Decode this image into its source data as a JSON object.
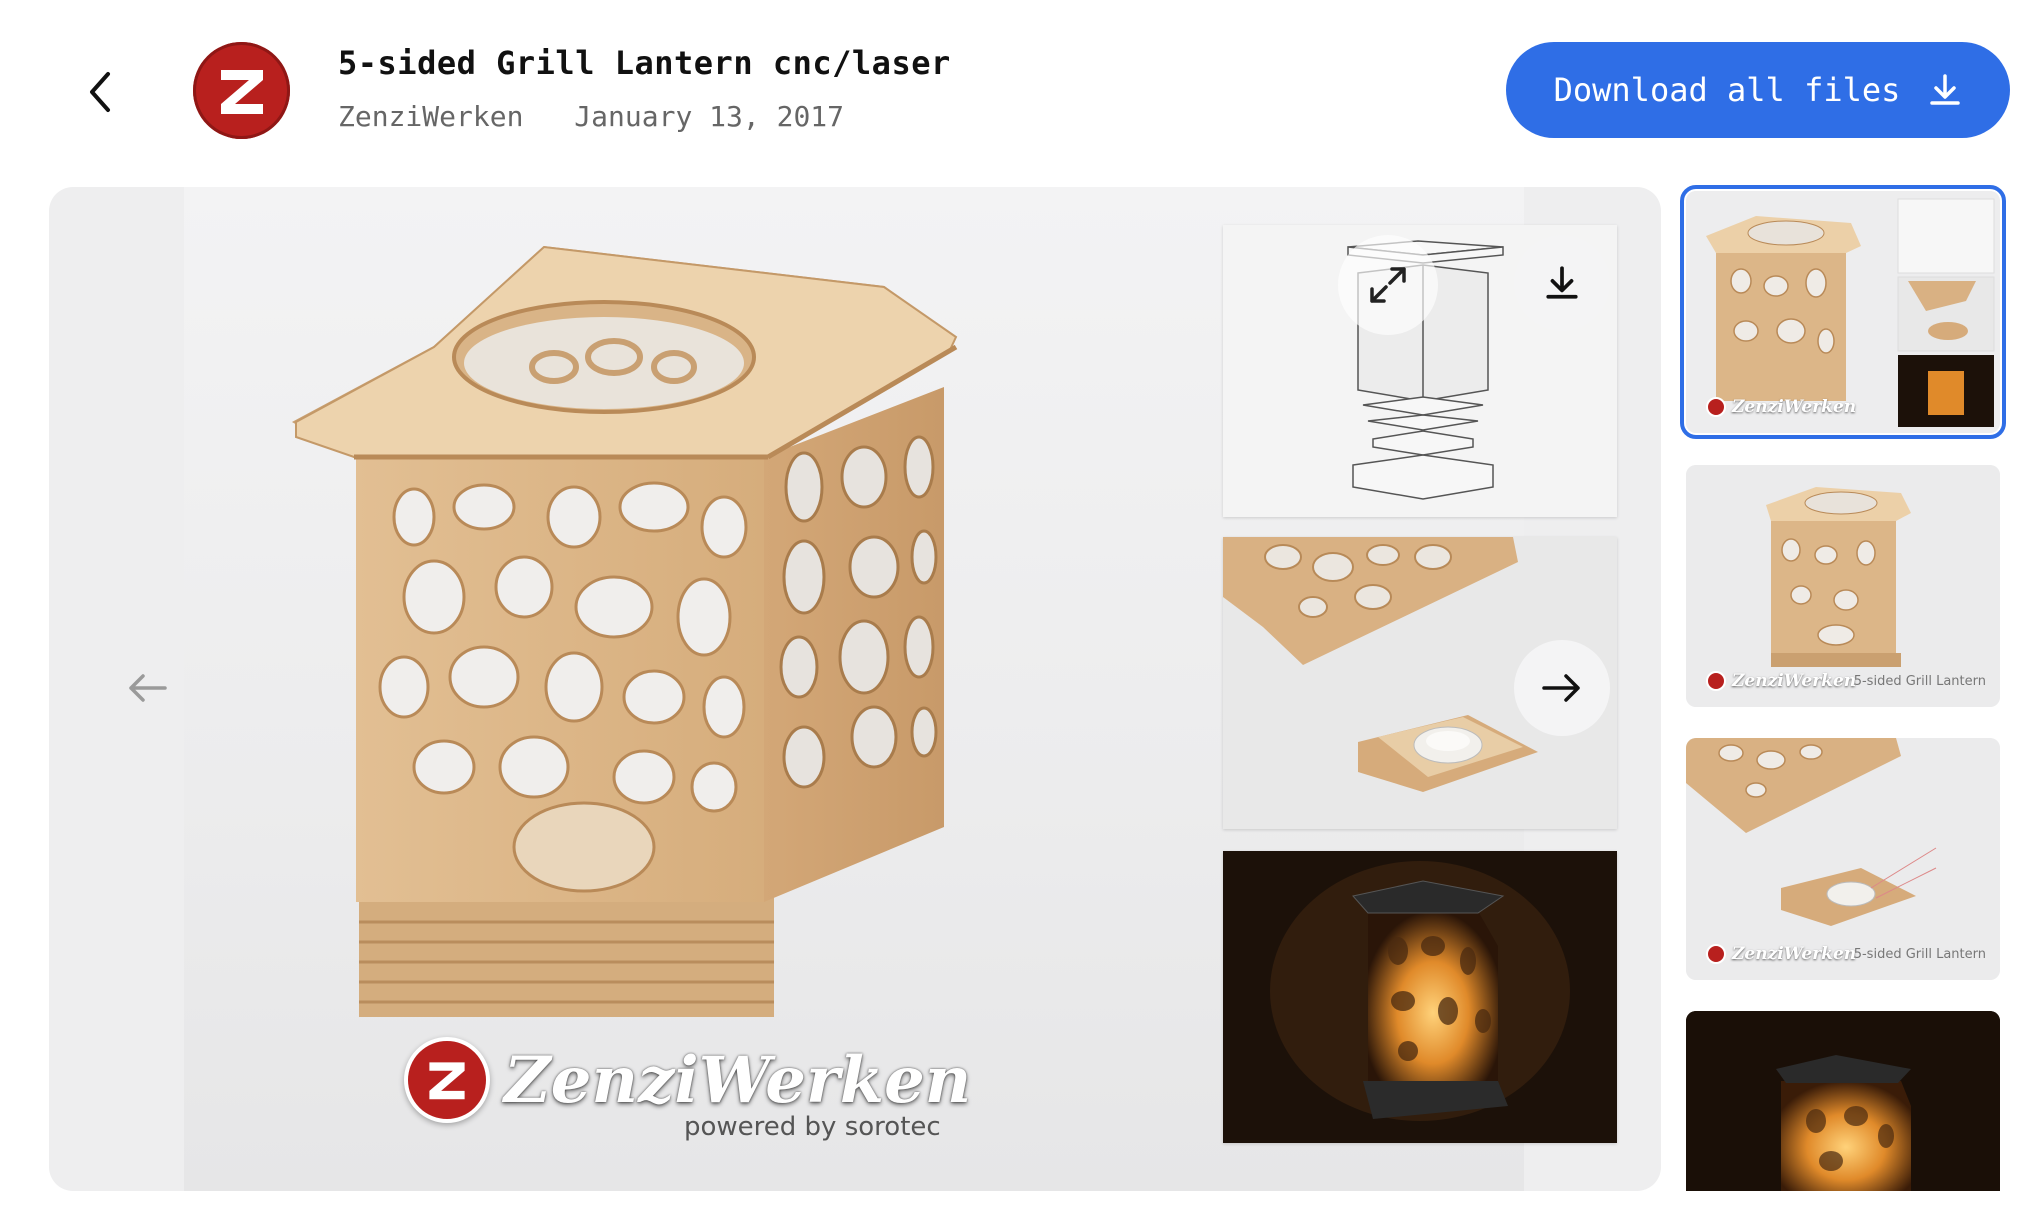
{
  "header": {
    "title": "5-sided Grill Lantern cnc/laser",
    "author": "ZenziWerken",
    "date": "January 13, 2017",
    "download_all_label": "Download all files"
  },
  "viewer": {
    "watermark_brand": "ZenziWerken",
    "watermark_sub": "powered by sorotec"
  },
  "thumbnails": [
    {
      "caption": "ZenziWerken",
      "sub": "",
      "selected": true
    },
    {
      "caption": "ZenziWerken",
      "sub": "5-sided Grill Lantern",
      "selected": false
    },
    {
      "caption": "ZenziWerken",
      "sub": "5-sided Grill Lantern",
      "selected": false
    },
    {
      "caption": "",
      "sub": "",
      "selected": false
    }
  ],
  "colors": {
    "accent": "#2f6ee6",
    "brand_red": "#b8201e",
    "wood": "#e6c49a"
  }
}
